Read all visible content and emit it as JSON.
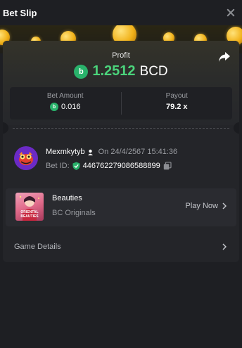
{
  "header": {
    "title": "Bet Slip"
  },
  "profit": {
    "label": "Profit",
    "amount": "1.2512",
    "currency": "BCD",
    "coin_icon": "b"
  },
  "stats": {
    "bet_amount_label": "Bet Amount",
    "bet_amount_value": "0.016",
    "payout_label": "Payout",
    "payout_value": "79.2 x"
  },
  "user": {
    "name": "Mexmkytyb",
    "time": "On 24/4/2567 15:41:36",
    "bet_id_label": "Bet ID:",
    "bet_id": "446762279086588899"
  },
  "game": {
    "name": "Beauties",
    "provider": "BC Originals",
    "play_label": "Play Now",
    "thumb_caption": "ORIENTAL BEAUTIES"
  },
  "details": {
    "label": "Game Details"
  },
  "colors": {
    "accent_green": "#4bd37b",
    "coin_green": "#29b26b",
    "background": "#1e1f23"
  }
}
